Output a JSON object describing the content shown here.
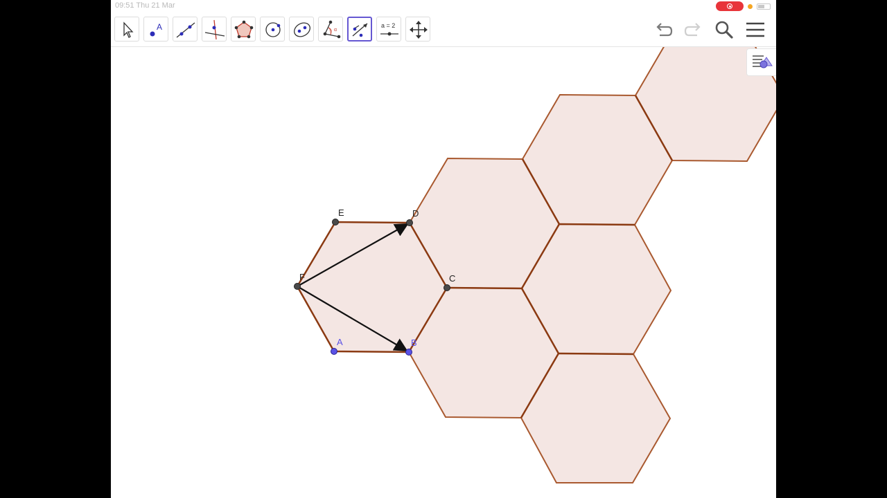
{
  "status": {
    "time": "09:51 Thu 21 Mar",
    "battery_percent": 55
  },
  "toolbar": {
    "slider_label": "a = 2",
    "point_tool_label": "A"
  },
  "points": {
    "A": "A",
    "B": "B",
    "C": "C",
    "D": "D",
    "E": "E",
    "F": "F"
  },
  "colors": {
    "hexagon_fill": "#f4e6e3",
    "hexagon_stroke": "#a9592f",
    "hexagon_stroke_dark": "#8b3a12",
    "vector": "#111111",
    "point_dark": "#4a4a4a",
    "point_free": "#5b52e6",
    "active_tool": "#6557d2",
    "record": "#e8343a"
  }
}
